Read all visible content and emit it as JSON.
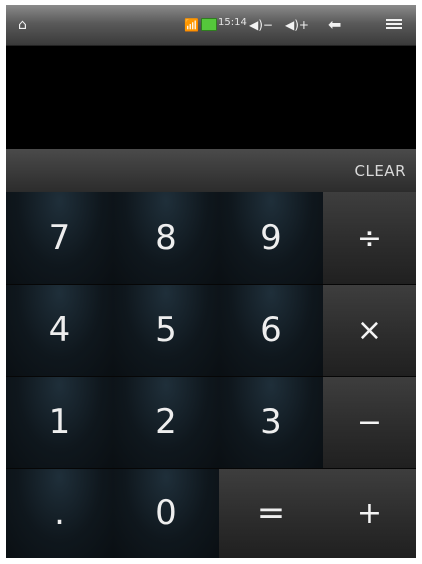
{
  "status_bar": {
    "clock": "15:14",
    "icons": [
      "home-icon",
      "signal-icon",
      "battery-icon",
      "volume-down-icon",
      "volume-up-icon",
      "back-icon",
      "menu-icon"
    ],
    "battery_color": "#55c83b"
  },
  "display": {
    "value": ""
  },
  "controls": {
    "clear_label": "CLEAR"
  },
  "keypad": {
    "rows": [
      [
        "7",
        "8",
        "9",
        "÷"
      ],
      [
        "4",
        "5",
        "6",
        "×"
      ],
      [
        "1",
        "2",
        "3",
        "−"
      ],
      [
        ".",
        "0",
        "=",
        "+"
      ]
    ]
  }
}
